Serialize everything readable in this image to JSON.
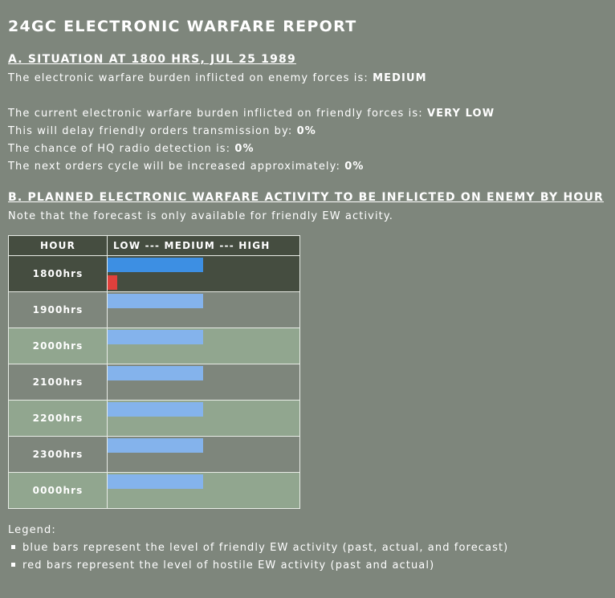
{
  "title": "24GC ELECTRONIC WARFARE REPORT",
  "section_a": {
    "heading": "A. SITUATION AT 1800 HRS, JUL 25 1989",
    "enemy_burden_label": "The electronic warfare burden inflicted on enemy forces is:",
    "enemy_burden_value": "MEDIUM",
    "friendly_burden_label": "The current electronic warfare burden inflicted on friendly forces is:",
    "friendly_burden_value": "VERY LOW",
    "delay_label": "This will delay friendly orders transmission by:",
    "delay_value": "0%",
    "detection_label": "The chance of HQ radio detection is:",
    "detection_value": "0%",
    "cycle_label": "The next orders cycle will be increased approximately:",
    "cycle_value": "0%"
  },
  "section_b": {
    "heading": "B. PLANNED ELECTRONIC WARFARE ACTIVITY TO BE INFLICTED ON ENEMY BY HOUR",
    "note": "Note that the forecast is only available for friendly EW activity."
  },
  "table": {
    "col_hour": "HOUR",
    "col_level": "LOW --- MEDIUM --- HIGH",
    "colors": {
      "friendly_actual": "#3d8fe3",
      "friendly_forecast": "#84b3ec",
      "hostile": "#e0403c"
    },
    "rows": [
      {
        "hour": "1800hrs",
        "friendly": 0.5,
        "hostile": 0.05,
        "forecast": false
      },
      {
        "hour": "1900hrs",
        "friendly": 0.5,
        "hostile": null,
        "forecast": true
      },
      {
        "hour": "2000hrs",
        "friendly": 0.5,
        "hostile": null,
        "forecast": true
      },
      {
        "hour": "2100hrs",
        "friendly": 0.5,
        "hostile": null,
        "forecast": true
      },
      {
        "hour": "2200hrs",
        "friendly": 0.5,
        "hostile": null,
        "forecast": true
      },
      {
        "hour": "2300hrs",
        "friendly": 0.5,
        "hostile": null,
        "forecast": true
      },
      {
        "hour": "0000hrs",
        "friendly": 0.5,
        "hostile": null,
        "forecast": true
      }
    ]
  },
  "legend": {
    "title": "Legend:",
    "items": [
      "blue bars represent the level of friendly EW activity (past, actual, and forecast)",
      "red bars represent the level of hostile EW activity (past and actual)"
    ]
  }
}
